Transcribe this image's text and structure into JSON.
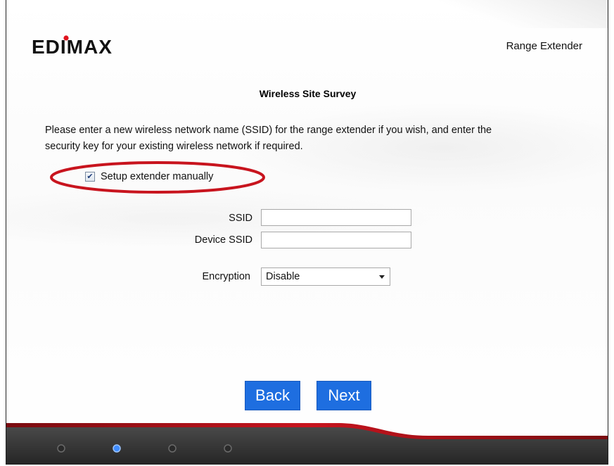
{
  "header": {
    "logo_text": "EDIMAX",
    "product_label": "Range Extender"
  },
  "page": {
    "title": "Wireless Site Survey",
    "description_line1": "Please enter a new wireless network name (SSID) for the range extender if you wish, and enter the",
    "description_line2": "security key for your existing wireless network if required."
  },
  "manual_setup": {
    "label": "Setup extender manually",
    "checked": true
  },
  "form": {
    "ssid_label": "SSID",
    "ssid_value": "",
    "device_ssid_label": "Device SSID",
    "device_ssid_value": "",
    "encryption_label": "Encryption",
    "encryption_value": "Disable"
  },
  "buttons": {
    "back_label": "Back",
    "next_label": "Next"
  },
  "progress": {
    "total_steps": 4,
    "current_step": 2
  },
  "colors": {
    "accent": "#1e6ee0",
    "highlight_ring": "#c8141e",
    "footer_band": "#3a3a3a",
    "footer_stripe": "#b3121b"
  },
  "icons": {
    "checkbox": "checkmark-icon",
    "dropdown": "chevron-down-icon",
    "step_dot": "circle-icon"
  }
}
